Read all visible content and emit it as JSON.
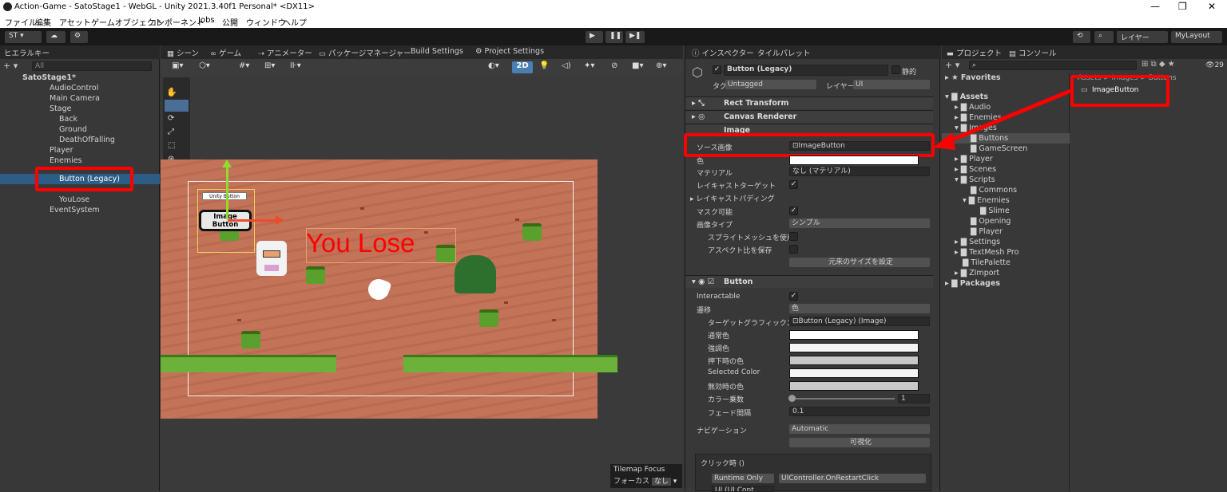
{
  "titlebar": {
    "title": "Action-Game - SatoStage1 - WebGL - Unity 2021.3.40f1 Personal* <DX11>",
    "minimize": "—",
    "maximize": "❐",
    "close": "✕"
  },
  "menu": [
    "ファイル",
    "編集",
    "アセット",
    "ゲームオブジェクト",
    "コンポーネント",
    "Jobs",
    "公開",
    "ウィンドウ",
    "ヘルプ"
  ],
  "toolbar": {
    "account": "ST ▾",
    "play": "▶",
    "pause": "❚❚",
    "step": "▶❚",
    "layers": "レイヤー",
    "layout": "MyLayout"
  },
  "hierarchy": {
    "tab": "ヒエラルキー",
    "search_placeholder": "All",
    "items": [
      "SatoStage1*",
      "AudioControl",
      "Main Camera",
      "Stage",
      "Back",
      "Ground",
      "DeathOfFalling",
      "Player",
      "Enemies",
      "",
      "Button (Legacy)",
      "",
      "YouLose",
      "EventSystem"
    ]
  },
  "scene": {
    "tabs": [
      "シーン",
      "ゲーム",
      "アニメーター",
      "パッケージマネージャー",
      "Build Settings",
      "Project Settings"
    ],
    "btn_2d": "2D",
    "unity_button": "Unity Button",
    "image_button": "Image Button",
    "you_lose": "You Lose",
    "tilemap_focus": "Tilemap Focus",
    "focus_label": "フォーカス",
    "focus_value": "なし"
  },
  "inspector": {
    "tabs": [
      "インスペクター",
      "タイルパレット"
    ],
    "object_name": "Button (Legacy)",
    "static_label": "静的",
    "tag_label": "タグ",
    "tag_value": "Untagged",
    "layer_label": "レイヤー",
    "layer_value": "UI",
    "components": [
      "Rect Transform",
      "Canvas Renderer",
      "Image",
      "Button"
    ],
    "image": {
      "source_label": "ソース画像",
      "source_value": "ImageButton",
      "color_label": "色",
      "material_label": "マテリアル",
      "material_value": "なし (マテリアル)",
      "raycast_label": "レイキャストターゲット",
      "raycast_padding": "レイキャストパディング",
      "maskable": "マスク可能",
      "image_type_label": "画像タイプ",
      "image_type_value": "シンプル",
      "sprite_mesh": "スプライトメッシュを使用",
      "aspect": "アスペクト比を保存",
      "native_size": "元来のサイズを設定"
    },
    "button": {
      "interactable": "Interactable",
      "transition_label": "遷移",
      "transition_value": "色",
      "target_graphic_label": "ターゲットグラフィックス",
      "target_graphic_value": "Button (Legacy) (Image)",
      "normal": "通常色",
      "highlight": "強調色",
      "pressed": "押下時の色",
      "selected": "Selected Color",
      "disabled": "無効時の色",
      "multiplier_label": "カラー乗数",
      "multiplier_value": "1",
      "fade_label": "フェード間隔",
      "fade_value": "0.1",
      "nav_label": "ナビゲーション",
      "nav_value": "Automatic",
      "visualize": "可視化",
      "onclick": "クリック時 ()",
      "runtime": "Runtime Only",
      "method": "UIController.OnRestartClick",
      "obj": "UI (UI Cont"
    }
  },
  "project": {
    "tabs": [
      "プロジェクト",
      "コンソール"
    ],
    "count": "29",
    "favorites": "Favorites",
    "assets": "Assets",
    "packages": "Packages",
    "breadcrumb": "Assets > Images > Buttons",
    "file": "ImageButton",
    "folders": [
      "Audio",
      "Enemies",
      "Images",
      "Buttons",
      "GameScreen",
      "Player",
      "Scenes",
      "Scripts",
      "Commons",
      "Enemies",
      "Slime",
      "Opening",
      "Player",
      "Settings",
      "TextMesh Pro",
      "TilePalette",
      "ZImport"
    ]
  }
}
